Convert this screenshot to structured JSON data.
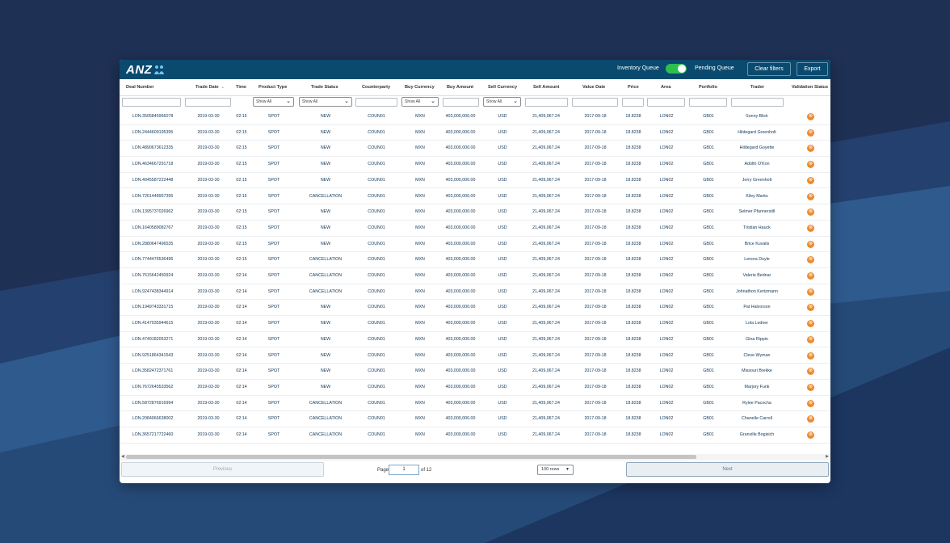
{
  "toolbar": {
    "logo": "ANZ",
    "inventory_queue": "Inventory Queue",
    "pending_queue": "Pending Queue",
    "clear_filters": "Clear filters",
    "export": "Export",
    "queue_toggle_on": true
  },
  "columns": [
    "Deal Number",
    "Trade Date",
    "Time",
    "Product Type",
    "Trade Status",
    "Counterparty",
    "Buy Currency",
    "Buy Amount",
    "Sell Currency",
    "Sell Amount",
    "Value Date",
    "Price",
    "Area",
    "Portfolio",
    "Trader",
    "Validation Status"
  ],
  "filters": {
    "product_type": "Show All",
    "trade_status": "Show All",
    "buy_currency": "Show All",
    "sell_currency": "Show All"
  },
  "rows": [
    [
      "LON.3505845966078",
      "2019-03-30",
      "02:15",
      "SPOT",
      "NEW",
      "COUN01",
      "MXN",
      "403,000,000.00",
      "USD",
      "21,409,067.24",
      "2017-09-18",
      "18.8238",
      "LON02",
      "GB01",
      "Sonny Blick"
    ],
    [
      "LON.2444609195395",
      "2019-03-30",
      "02:15",
      "SPOT",
      "NEW",
      "COUN01",
      "MXN",
      "403,000,000.00",
      "USD",
      "21,409,067.24",
      "2017-09-18",
      "18.8238",
      "LON02",
      "GB01",
      "Hildegard Greenholt"
    ],
    [
      "LON.4890673612335",
      "2019-03-30",
      "02:15",
      "SPOT",
      "NEW",
      "COUN01",
      "MXN",
      "403,000,000.00",
      "USD",
      "21,409,067.24",
      "2017-09-18",
      "18.8238",
      "LON02",
      "GB01",
      "Hildegard Goyette"
    ],
    [
      "LON.4634667291718",
      "2019-03-30",
      "02:15",
      "SPOT",
      "NEW",
      "COUN01",
      "MXN",
      "403,000,000.00",
      "USD",
      "21,409,067.24",
      "2017-09-18",
      "18.8238",
      "LON02",
      "GB01",
      "Adolfo O'Kon"
    ],
    [
      "LON.4045587222448",
      "2019-03-30",
      "02:15",
      "SPOT",
      "NEW",
      "COUN01",
      "MXN",
      "403,000,000.00",
      "USD",
      "21,409,067.24",
      "2017-09-18",
      "18.8238",
      "LON02",
      "GB01",
      "Jerry Greenholt"
    ],
    [
      "LON.7261448957395",
      "2019-03-30",
      "02:15",
      "SPOT",
      "CANCELLATION",
      "COUN01",
      "MXN",
      "403,000,000.00",
      "USD",
      "21,409,067.24",
      "2017-09-18",
      "18.8238",
      "LON02",
      "GB01",
      "Kiley Marks"
    ],
    [
      "LON.1395737026962",
      "2019-03-30",
      "02:15",
      "SPOT",
      "NEW",
      "COUN01",
      "MXN",
      "403,000,000.00",
      "USD",
      "21,409,067.24",
      "2017-09-18",
      "18.8238",
      "LON02",
      "GB01",
      "Selmer Pfannerstill"
    ],
    [
      "LON.1640589082767",
      "2019-03-30",
      "02:15",
      "SPOT",
      "NEW",
      "COUN01",
      "MXN",
      "403,000,000.00",
      "USD",
      "21,409,067.24",
      "2017-09-18",
      "18.8238",
      "LON02",
      "GB01",
      "Tristian Hauck"
    ],
    [
      "LON.2880647496535",
      "2019-03-30",
      "02:15",
      "SPOT",
      "NEW",
      "COUN01",
      "MXN",
      "403,000,000.00",
      "USD",
      "21,409,067.24",
      "2017-09-18",
      "18.8238",
      "LON02",
      "GB01",
      "Brice Kuvalis"
    ],
    [
      "LON.7744476536496",
      "2019-03-30",
      "02:15",
      "SPOT",
      "CANCELLATION",
      "COUN01",
      "MXN",
      "403,000,000.00",
      "USD",
      "21,409,067.24",
      "2017-09-18",
      "18.8238",
      "LON02",
      "GB01",
      "Lenora Doyle"
    ],
    [
      "LON.7615642450924",
      "2019-03-30",
      "02:14",
      "SPOT",
      "CANCELLATION",
      "COUN01",
      "MXN",
      "403,000,000.00",
      "USD",
      "21,409,067.24",
      "2017-09-18",
      "18.8238",
      "LON02",
      "GB01",
      "Valerie Bednar"
    ],
    [
      "LON.9247438344914",
      "2019-03-30",
      "02:14",
      "SPOT",
      "CANCELLATION",
      "COUN01",
      "MXN",
      "403,000,000.00",
      "USD",
      "21,409,067.24",
      "2017-09-18",
      "18.8238",
      "LON02",
      "GB01",
      "Johnathon Kertzmann"
    ],
    [
      "LON.1949743331715",
      "2019-03-30",
      "02:14",
      "SPOT",
      "NEW",
      "COUN01",
      "MXN",
      "403,000,000.00",
      "USD",
      "21,409,067.24",
      "2017-09-18",
      "18.8238",
      "LON02",
      "GB01",
      "Pat Halvorson"
    ],
    [
      "LON.4147035944615",
      "2019-03-30",
      "02:14",
      "SPOT",
      "NEW",
      "COUN01",
      "MXN",
      "403,000,000.00",
      "USD",
      "21,409,067.24",
      "2017-09-18",
      "18.8238",
      "LON02",
      "GB01",
      "Lola Ledner"
    ],
    [
      "LON.4749182053271",
      "2019-03-30",
      "02:14",
      "SPOT",
      "NEW",
      "COUN01",
      "MXN",
      "403,000,000.00",
      "USD",
      "21,409,067.24",
      "2017-09-18",
      "18.8238",
      "LON02",
      "GB01",
      "Gina Rippin"
    ],
    [
      "LON.9251864341543",
      "2019-03-30",
      "02:14",
      "SPOT",
      "NEW",
      "COUN01",
      "MXN",
      "403,000,000.00",
      "USD",
      "21,409,067.24",
      "2017-09-18",
      "18.8238",
      "LON02",
      "GB01",
      "Cleve Wyman"
    ],
    [
      "LON.3582472371761",
      "2019-03-30",
      "02:14",
      "SPOT",
      "NEW",
      "COUN01",
      "MXN",
      "403,000,000.00",
      "USD",
      "21,409,067.24",
      "2017-09-18",
      "18.8238",
      "LON02",
      "GB01",
      "Missouri Brekke"
    ],
    [
      "LON.7672645533562",
      "2019-03-30",
      "02:14",
      "SPOT",
      "NEW",
      "COUN01",
      "MXN",
      "403,000,000.00",
      "USD",
      "21,409,067.24",
      "2017-09-18",
      "18.8238",
      "LON02",
      "GB01",
      "Marjory Funk"
    ],
    [
      "LON.5872876916994",
      "2019-03-30",
      "02:14",
      "SPOT",
      "CANCELLATION",
      "COUN01",
      "MXN",
      "403,000,000.00",
      "USD",
      "21,409,067.24",
      "2017-09-18",
      "18.8238",
      "LON02",
      "GB01",
      "Rylee Pacocha"
    ],
    [
      "LON.2084966638002",
      "2019-03-30",
      "02:14",
      "SPOT",
      "CANCELLATION",
      "COUN01",
      "MXN",
      "403,000,000.00",
      "USD",
      "21,409,067.24",
      "2017-09-18",
      "18.8238",
      "LON02",
      "GB01",
      "Chanelle Carroll"
    ],
    [
      "LON.3657217722460",
      "2019-03-30",
      "02:14",
      "SPOT",
      "CANCELLATION",
      "COUN01",
      "MXN",
      "403,000,000.00",
      "USD",
      "21,409,067.24",
      "2017-09-18",
      "18.8238",
      "LON02",
      "GB01",
      "Granville Bogisich"
    ]
  ],
  "pagination": {
    "previous": "Previous",
    "next": "Next",
    "page_label": "Page",
    "page_value": "1",
    "of_label": "of 12",
    "rows_option": "100 rows"
  },
  "colors": {
    "header_bg": "#0a4a6e",
    "toggle_on": "#2ebf4f",
    "validation_icon": "#ee8a2e",
    "page_bg": "#1e2f52"
  },
  "icons": {
    "validation": "error-circle-icon",
    "dropdown": "chevron-down-icon",
    "logo": "anz-people-icon"
  }
}
